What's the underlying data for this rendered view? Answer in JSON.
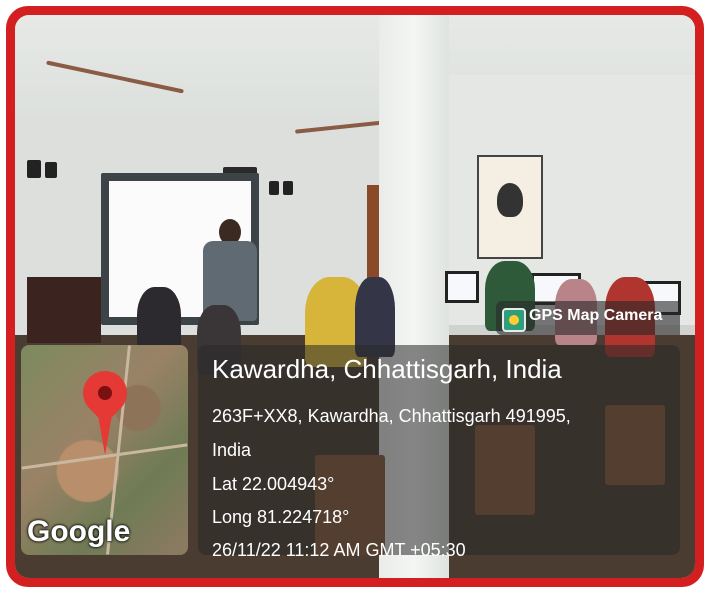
{
  "app_badge": {
    "label": "GPS Map Camera",
    "icon": "gps-map-camera-icon"
  },
  "location": {
    "title": "Kawardha, Chhattisgarh, India",
    "address_line1": "263F+XX8, Kawardha, Chhattisgarh 491995,",
    "address_line2": "India",
    "latitude": "Lat 22.004943°",
    "longitude": "Long 81.224718°",
    "timestamp": "26/11/22 11:12 AM GMT +05:30"
  },
  "map": {
    "provider_logo": "Google",
    "pin_icon": "map-pin-icon",
    "pin_color": "#e53935"
  },
  "colors": {
    "frame": "#d31f1f"
  }
}
